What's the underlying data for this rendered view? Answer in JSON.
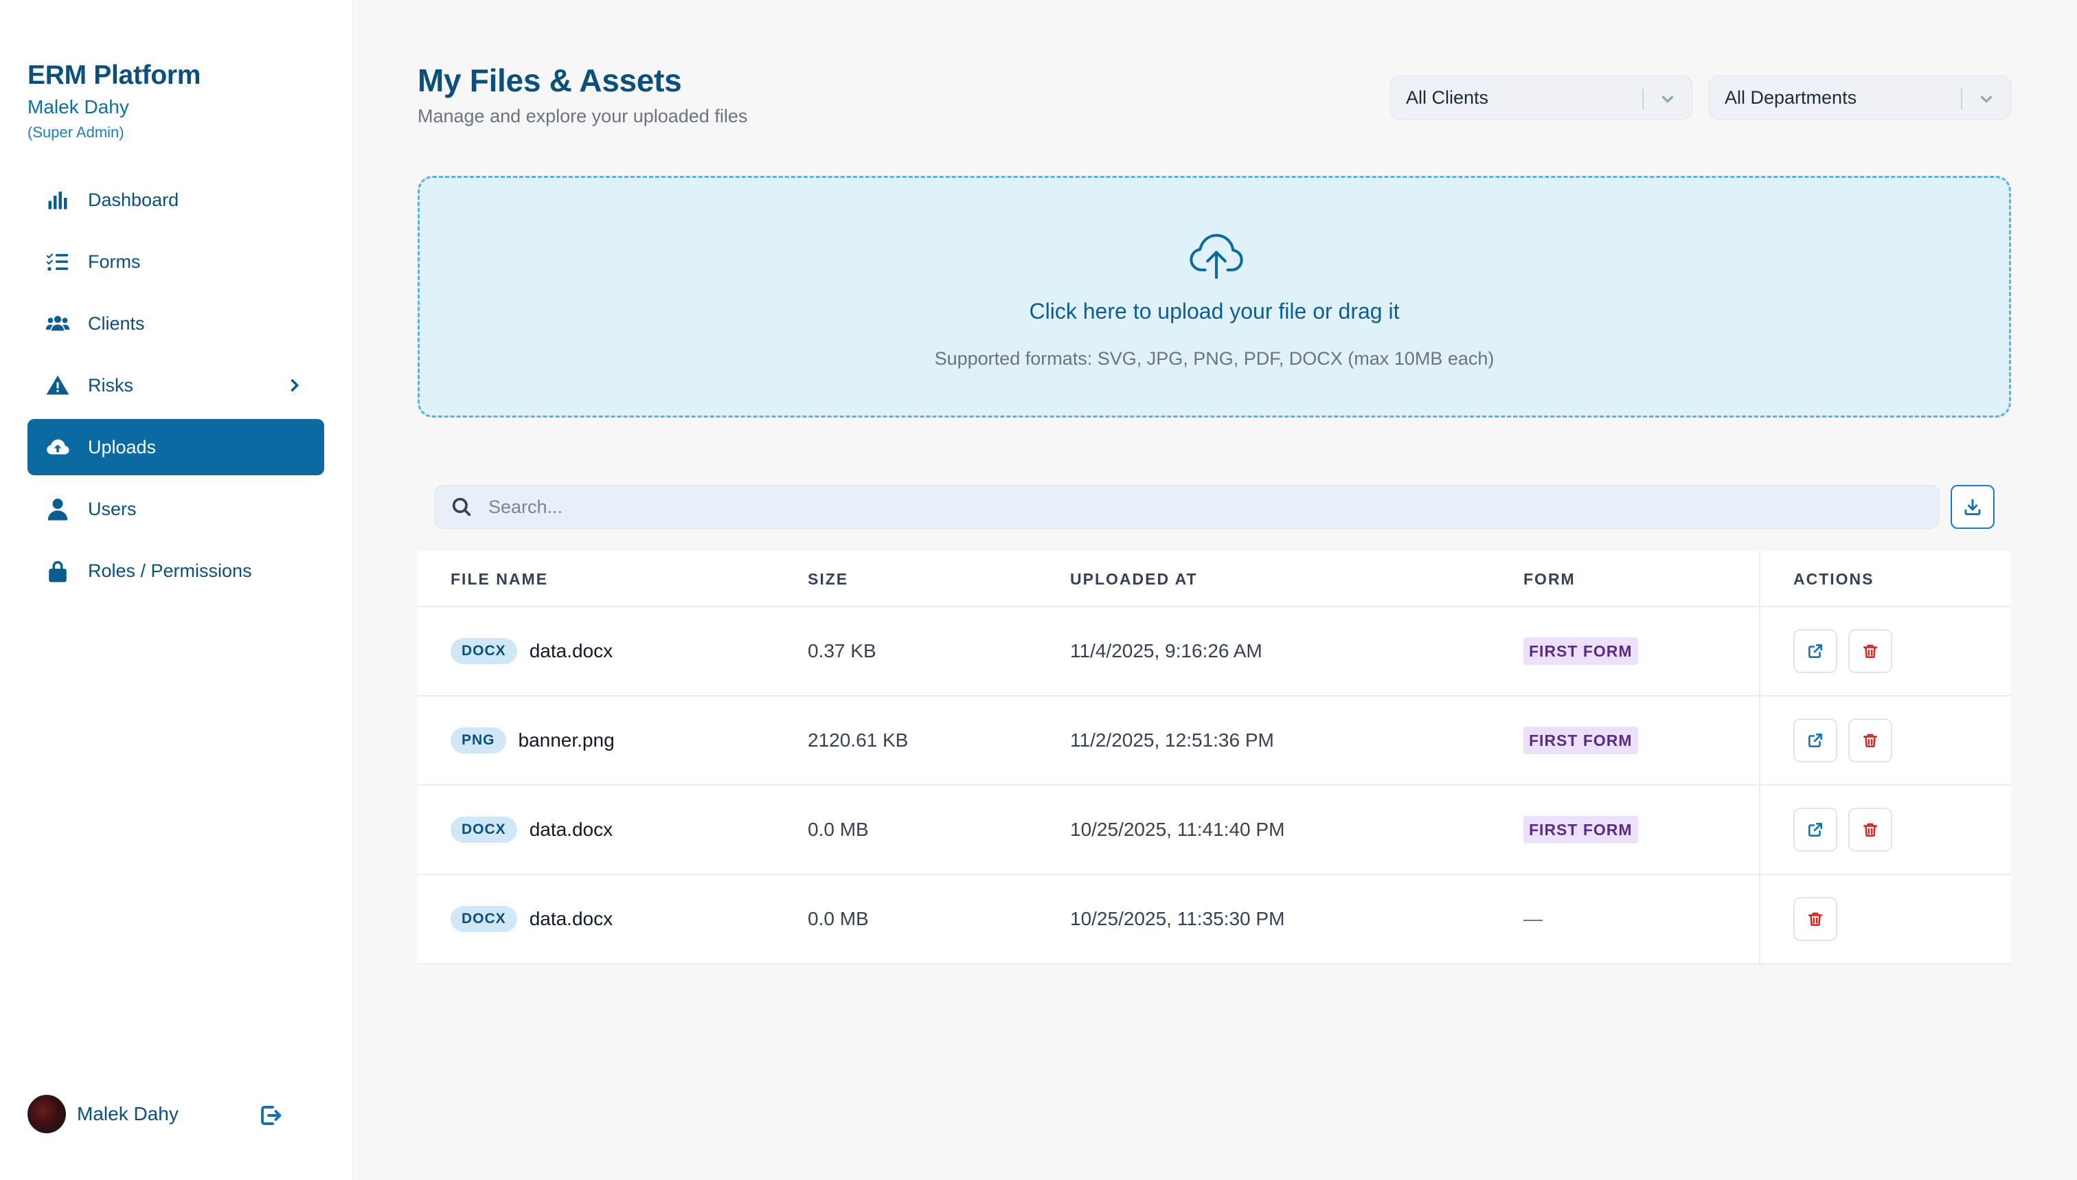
{
  "app": {
    "brand_title": "ERM Platform",
    "user_name": "Malek Dahy",
    "user_role": "(Super Admin)"
  },
  "sidebar": {
    "items": [
      {
        "label": "Dashboard",
        "icon": "bar-chart-icon",
        "active": false
      },
      {
        "label": "Forms",
        "icon": "checklist-icon",
        "active": false
      },
      {
        "label": "Clients",
        "icon": "users-group-icon",
        "active": false
      },
      {
        "label": "Risks",
        "icon": "warning-triangle-icon",
        "active": false,
        "has_submenu": true
      },
      {
        "label": "Uploads",
        "icon": "cloud-upload-icon",
        "active": true
      },
      {
        "label": "Users",
        "icon": "user-icon",
        "active": false
      },
      {
        "label": "Roles / Permissions",
        "icon": "lock-icon",
        "active": false
      }
    ],
    "footer_name": "Malek Dahy"
  },
  "header": {
    "title": "My Files & Assets",
    "subtitle": "Manage and explore your uploaded files",
    "client_filter": "All Clients",
    "department_filter": "All Departments"
  },
  "dropzone": {
    "title": "Click here to upload your file or drag it",
    "subtitle": "Supported formats: SVG, JPG, PNG, PDF, DOCX (max 10MB each)"
  },
  "search": {
    "placeholder": "Search...",
    "value": ""
  },
  "table": {
    "columns": [
      "FILE NAME",
      "SIZE",
      "UPLOADED AT",
      "FORM",
      "ACTIONS"
    ],
    "rows": [
      {
        "ext": "DOCX",
        "name": "data.docx",
        "size": "0.37 KB",
        "uploaded_at": "11/4/2025, 9:16:26 AM",
        "form": "FIRST FORM",
        "has_form": true
      },
      {
        "ext": "PNG",
        "name": "banner.png",
        "size": "2120.61 KB",
        "uploaded_at": "11/2/2025, 12:51:36 PM",
        "form": "FIRST FORM",
        "has_form": true
      },
      {
        "ext": "DOCX",
        "name": "data.docx",
        "size": "0.0 MB",
        "uploaded_at": "10/25/2025, 11:41:40 PM",
        "form": "FIRST FORM",
        "has_form": true
      },
      {
        "ext": "DOCX",
        "name": "data.docx",
        "size": "0.0 MB",
        "uploaded_at": "10/25/2025, 11:35:30 PM",
        "form": "—",
        "has_form": false
      }
    ]
  },
  "colors": {
    "brand": "#0b4f7c",
    "active_nav": "#0b6aa2",
    "dropzone_bg": "#e1f1fa",
    "dropzone_border": "#59b3de",
    "form_badge_bg": "#ede0fb",
    "delete": "#d12a2a"
  }
}
